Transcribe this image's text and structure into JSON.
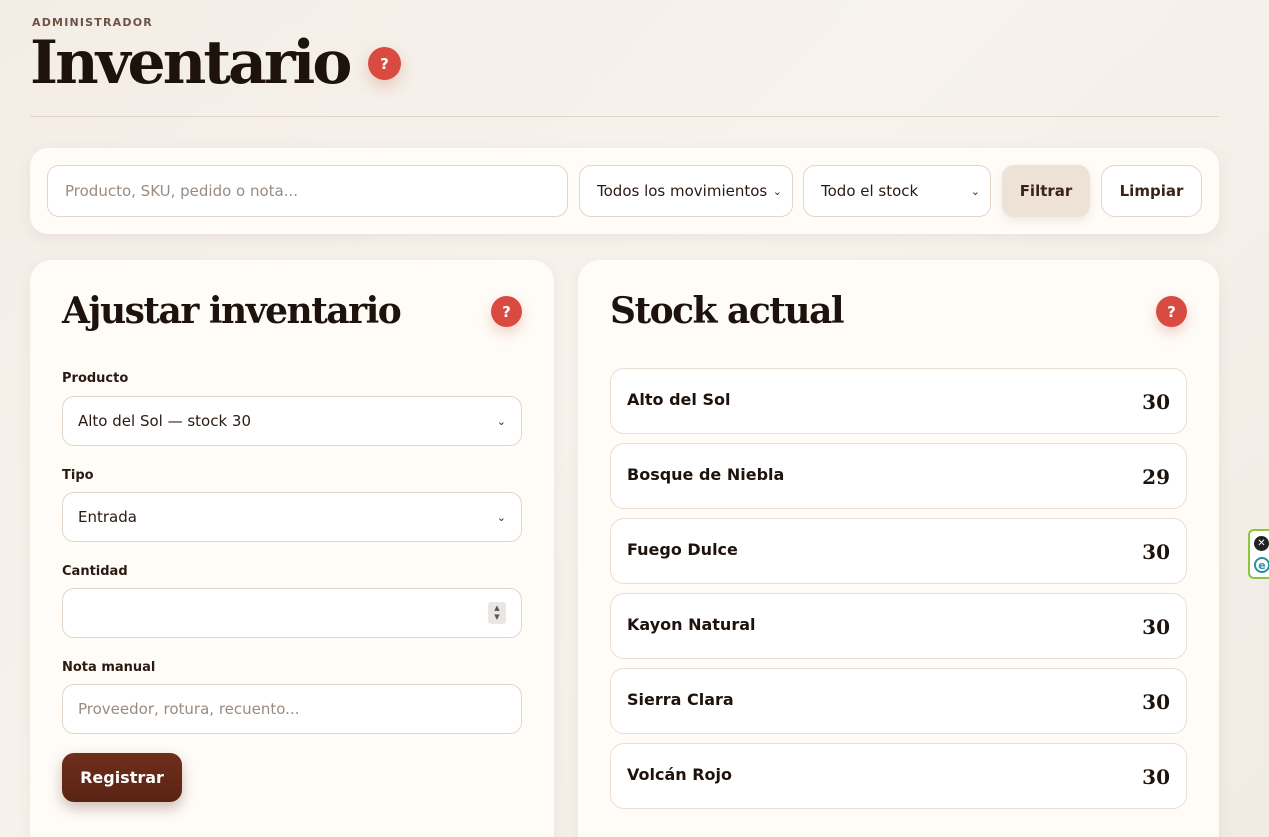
{
  "header": {
    "eyebrow": "ADMINISTRADOR",
    "title": "Inventario",
    "help": "?"
  },
  "filters": {
    "search_placeholder": "Producto, SKU, pedido o nota...",
    "movements_select": "Todos los movimientos",
    "stock_select": "Todo el stock",
    "filter_button": "Filtrar",
    "clear_button": "Limpiar"
  },
  "adjust": {
    "title": "Ajustar inventario",
    "help": "?",
    "product_label": "Producto",
    "product_value": "Alto del Sol — stock 30",
    "type_label": "Tipo",
    "type_value": "Entrada",
    "quantity_label": "Cantidad",
    "quantity_value": "",
    "note_label": "Nota manual",
    "note_placeholder": "Proveedor, rotura, recuento...",
    "register_button": "Registrar"
  },
  "stock": {
    "title": "Stock actual",
    "help": "?",
    "items": [
      {
        "name": "Alto del Sol",
        "qty": "30"
      },
      {
        "name": "Bosque de Niebla",
        "qty": "29"
      },
      {
        "name": "Fuego Dulce",
        "qty": "30"
      },
      {
        "name": "Kayon Natural",
        "qty": "30"
      },
      {
        "name": "Sierra Clara",
        "qty": "30"
      },
      {
        "name": "Volcán Rojo",
        "qty": "30"
      }
    ]
  },
  "extension": {
    "close_icon": "✕",
    "e_icon": "e"
  },
  "colors": {
    "accent_red": "#d94a40",
    "primary_brown": "#5a2414",
    "background": "#f5efe8"
  }
}
